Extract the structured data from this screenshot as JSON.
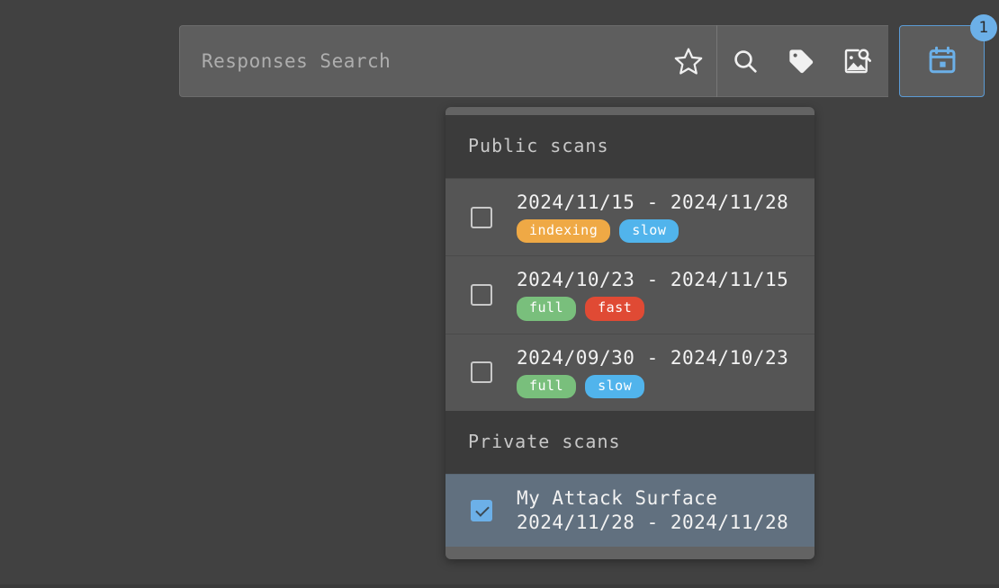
{
  "search": {
    "placeholder": "Responses Search",
    "value": "",
    "icons": [
      {
        "name": "star-icon",
        "label": "favorite"
      },
      {
        "name": "search-icon",
        "label": "search"
      },
      {
        "name": "tag-icon",
        "label": "tags"
      },
      {
        "name": "image-search-icon",
        "label": "image search"
      }
    ],
    "calendar_button": {
      "icon": "calendar-icon",
      "badge_count": "1",
      "active": true
    }
  },
  "colors": {
    "accent_blue": "#6cb0e8",
    "page_background": "#414141",
    "panel_background": "#3b3b3b",
    "row_background": "#555555",
    "row_selected_background": "#61707f",
    "tag_indexing": "#efa945",
    "tag_slow": "#51b4ec",
    "tag_full": "#79bf7c",
    "tag_fast": "#e04a34"
  },
  "dropdown": {
    "groups": [
      {
        "title": "Public scans",
        "rows": [
          {
            "checked": false,
            "name": "",
            "date_range": "2024/11/15 - 2024/11/28",
            "tags": [
              {
                "label": "indexing",
                "style": "tag-indexing"
              },
              {
                "label": "slow",
                "style": "tag-slow"
              }
            ]
          },
          {
            "checked": false,
            "name": "",
            "date_range": "2024/10/23 - 2024/11/15",
            "tags": [
              {
                "label": "full",
                "style": "tag-full"
              },
              {
                "label": "fast",
                "style": "tag-fast"
              }
            ]
          },
          {
            "checked": false,
            "name": "",
            "date_range": "2024/09/30 - 2024/10/23",
            "tags": [
              {
                "label": "full",
                "style": "tag-full"
              },
              {
                "label": "slow",
                "style": "tag-slow"
              }
            ]
          }
        ]
      },
      {
        "title": "Private scans",
        "rows": [
          {
            "checked": true,
            "name": "My Attack Surface",
            "date_range": "2024/11/28 - 2024/11/28",
            "tags": []
          }
        ]
      }
    ]
  }
}
